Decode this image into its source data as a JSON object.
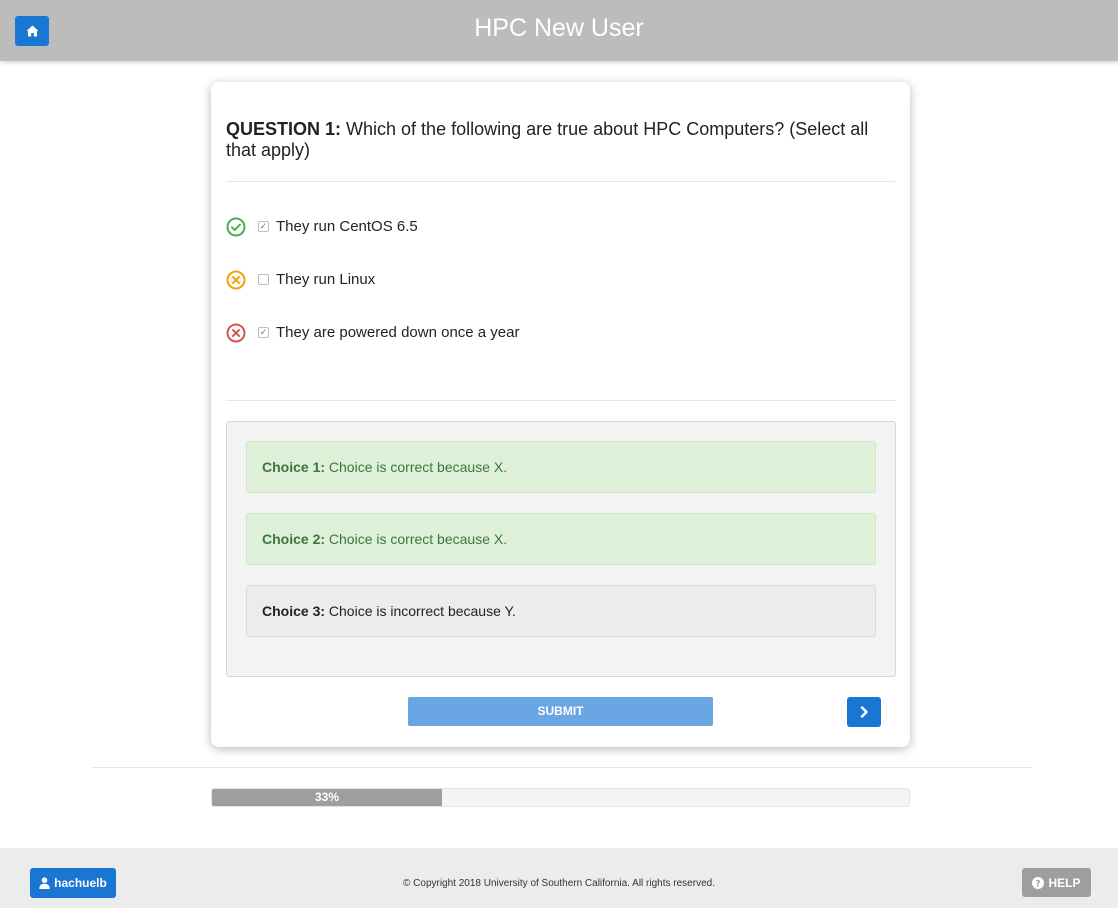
{
  "header": {
    "title": "HPC New User",
    "home_icon": "home-icon"
  },
  "question": {
    "number_label": "QUESTION 1:",
    "text": "Which of the following are true about HPC Computers? (Select all that apply)"
  },
  "options": [
    {
      "label": "They run CentOS 6.5",
      "checked": true,
      "status": "correct",
      "status_icon": "check-circle-icon",
      "color": "#4cae4c"
    },
    {
      "label": "They run Linux",
      "checked": false,
      "status": "missed",
      "status_icon": "x-circle-icon",
      "color": "#f0a30a"
    },
    {
      "label": "They are powered down once a year",
      "checked": true,
      "status": "incorrect",
      "status_icon": "x-circle-icon",
      "color": "#d9534f"
    }
  ],
  "feedback": [
    {
      "title": "Choice 1:",
      "text": "Choice is correct because X.",
      "type": "correct"
    },
    {
      "title": "Choice 2:",
      "text": "Choice is correct because X.",
      "type": "correct"
    },
    {
      "title": "Choice 3:",
      "text": "Choice is incorrect because Y.",
      "type": "incorrect"
    }
  ],
  "actions": {
    "submit_label": "SUBMIT",
    "next_icon": "chevron-right-icon"
  },
  "progress": {
    "percent": 33,
    "label": "33%"
  },
  "footer": {
    "user_label": "hachuelb",
    "user_icon": "user-icon",
    "copyright": "© Copyright 2018 University of Southern California. All rights reserved.",
    "help_label": "HELP",
    "help_icon": "question-circle-icon"
  },
  "colors": {
    "primary": "#1976d2",
    "submit": "#6aa5e4",
    "header_bg": "#bcbcbc",
    "correct_bg": "#dff0d8",
    "correct_text": "#3c763d"
  }
}
